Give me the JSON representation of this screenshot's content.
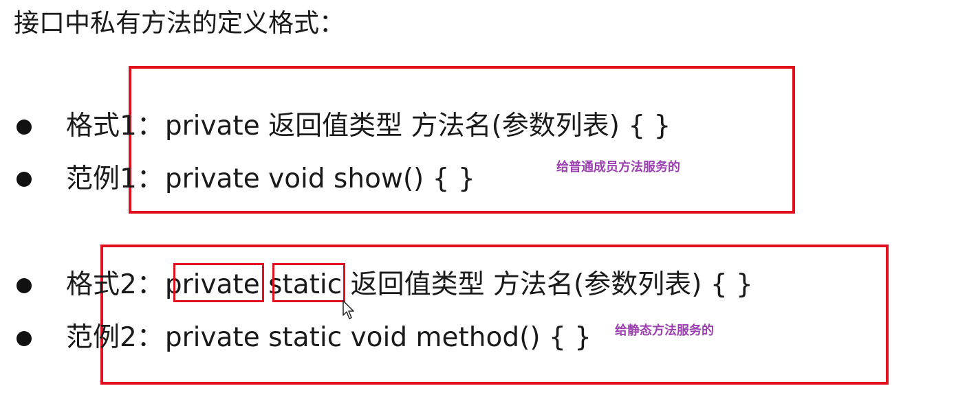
{
  "title": "接口中私有方法的定义格式：",
  "group1": {
    "format_label": "格式1：",
    "format_code": "private 返回值类型 方法名(参数列表) {   }",
    "example_label": "范例1：",
    "example_code": "private void show() {   }",
    "note": "给普通成员方法服务的"
  },
  "group2": {
    "format_label": "格式2：",
    "format_code_kw1": "private",
    "format_code_kw2": "static",
    "format_code_rest": "返回值类型 方法名(参数列表) {   }",
    "example_label": "范例2：",
    "example_code": "private static void method() {   }",
    "note": "给静态方法服务的"
  },
  "colors": {
    "highlight_box": "#e01020",
    "note_text": "#9b3fb0"
  },
  "icons": [
    "bullet-icon",
    "mouse-cursor-icon"
  ]
}
